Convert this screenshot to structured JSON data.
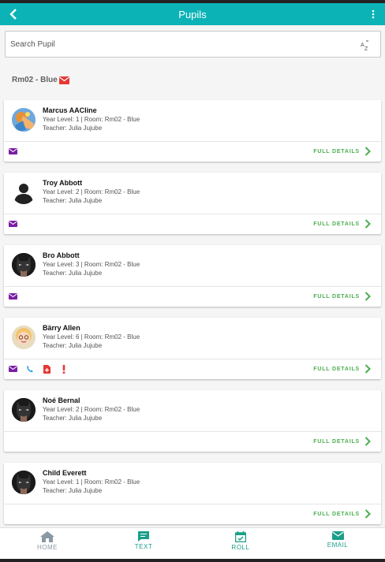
{
  "header": {
    "title": "Pupils"
  },
  "search": {
    "placeholder": "Search Pupil"
  },
  "group": {
    "label": "Rm02 - Blue"
  },
  "pupils": [
    {
      "name": "Marcus AACline",
      "details": "Year Level: 1 | Room: Rm02 - Blue",
      "teacher": "Teacher: Julia Jujube",
      "full_details": "FULL DETAILS"
    },
    {
      "name": "Troy Abbott",
      "details": "Year Level: 2 | Room: Rm02 - Blue",
      "teacher": "Teacher: Julia Jujube",
      "full_details": "FULL DETAILS"
    },
    {
      "name": "Bro Abbott",
      "details": "Year Level: 3 | Room: Rm02 - Blue",
      "teacher": "Teacher: Julia Jujube",
      "full_details": "FULL DETAILS"
    },
    {
      "name": "Bärry Allen",
      "details": "Year Level: 6 | Room: Rm02 - Blue",
      "teacher": "Teacher: Julia Jujube",
      "full_details": "FULL DETAILS"
    },
    {
      "name": "Noé Bernal",
      "details": "Year Level: 2 | Room: Rm02 - Blue",
      "teacher": "Teacher: Julia Jujube",
      "full_details": "FULL DETAILS"
    },
    {
      "name": "Child Everett",
      "details": "Year Level: 1 | Room: Rm02 - Blue",
      "teacher": "Teacher: Julia Jujube",
      "full_details": "FULL DETAILS"
    }
  ],
  "nav": {
    "home": "HOME",
    "text": "TEXT",
    "roll": "ROLL",
    "email": "EMAIL"
  },
  "colors": {
    "appbar": "#0cb3b6",
    "accent_green": "#4caf50",
    "nav_teal": "#1b9e8a",
    "nav_gray": "#8a9aa5",
    "email_icon": "#7b1fa2",
    "phone_icon": "#29a8e0",
    "alert_icon": "#e53935"
  }
}
